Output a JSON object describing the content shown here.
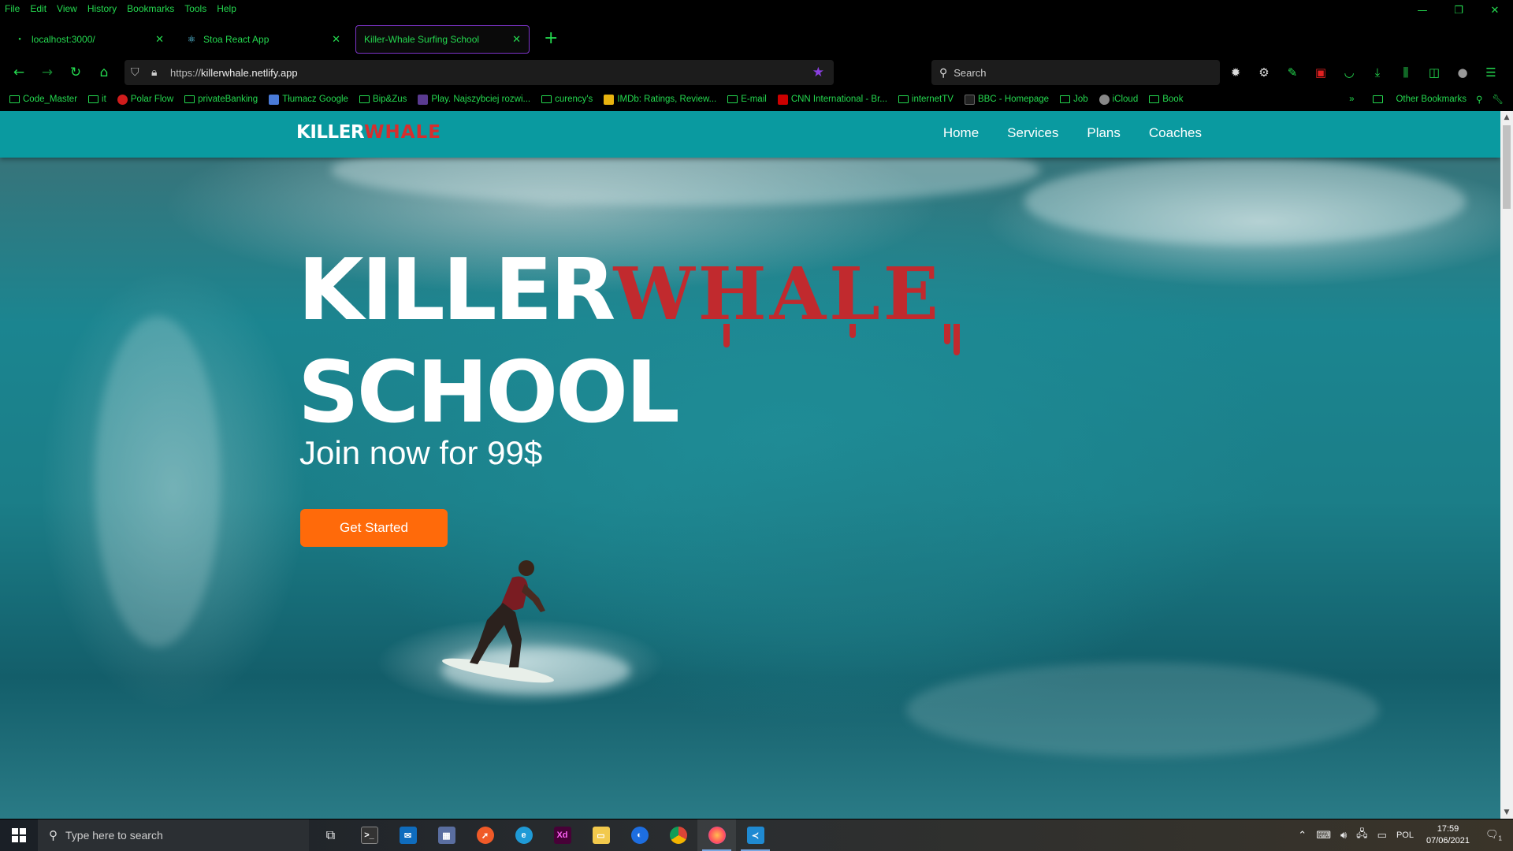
{
  "menu": [
    "File",
    "Edit",
    "View",
    "History",
    "Bookmarks",
    "Tools",
    "Help"
  ],
  "tabs": [
    {
      "title": "localhost:3000/"
    },
    {
      "title": "Stoa React App"
    },
    {
      "title": "Killer-Whale Surfing School"
    }
  ],
  "address": {
    "prefix": "https://",
    "host": "killerwhale.netlify.app"
  },
  "search_placeholder": "Search",
  "bookmarks": [
    {
      "label": "Code_Master",
      "kind": "folder"
    },
    {
      "label": "it",
      "kind": "folder"
    },
    {
      "label": "Polar Flow",
      "kind": "site",
      "color": "#d01c1c"
    },
    {
      "label": "privateBanking",
      "kind": "folder"
    },
    {
      "label": "Tłumacz Google",
      "kind": "site",
      "color": "#4a7bd8"
    },
    {
      "label": "Bip&Zus",
      "kind": "folder"
    },
    {
      "label": "Play. Najszybciej rozwi...",
      "kind": "site",
      "color": "#5a3a90"
    },
    {
      "label": "curency's",
      "kind": "folder"
    },
    {
      "label": "IMDb: Ratings, Review...",
      "kind": "site",
      "color": "#e8b30f"
    },
    {
      "label": "E-mail",
      "kind": "folder"
    },
    {
      "label": "CNN International - Br...",
      "kind": "site",
      "color": "#cc0000"
    },
    {
      "label": "internetTV",
      "kind": "folder"
    },
    {
      "label": "BBC - Homepage",
      "kind": "site",
      "color": "#222222"
    },
    {
      "label": "Job",
      "kind": "folder"
    },
    {
      "label": "iCloud",
      "kind": "site",
      "color": "#888888"
    },
    {
      "label": "Book",
      "kind": "folder"
    }
  ],
  "other_bookmarks": "Other Bookmarks",
  "site": {
    "logo_part1": "KILLER",
    "logo_part2": "WHALE",
    "nav": [
      "Home",
      "Services",
      "Plans",
      "Coaches"
    ],
    "hero_word1": "KILLER",
    "hero_word2": "WHALE",
    "hero_line2": "SCHOOL",
    "hero_tagline": "Join now for 99$",
    "cta": "Get Started"
  },
  "taskbar": {
    "search_placeholder": "Type here to search",
    "language": "POL",
    "time": "17:59",
    "date": "07/06/2021",
    "notifications": "1"
  },
  "colors": {
    "browser_accent": "#24d94f",
    "active_tab_border": "#7d34c9",
    "site_header": "#0a9aa0",
    "whale_red": "#c12a2e",
    "cta_orange": "#ff6a0a"
  }
}
